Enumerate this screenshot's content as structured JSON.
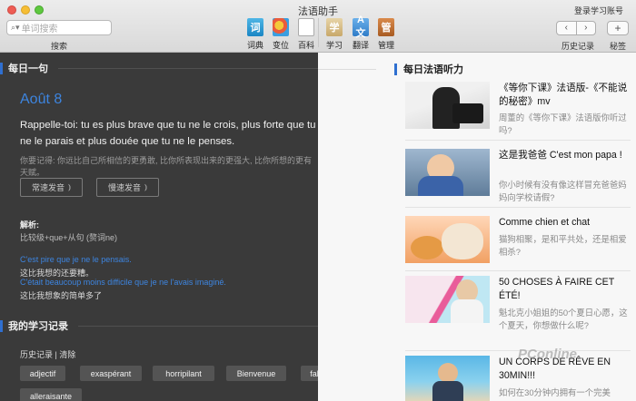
{
  "window": {
    "title": "法语助手",
    "login": "登录学习账号"
  },
  "toolbar": {
    "search_placeholder": "单词搜索",
    "search_caption": "搜索",
    "tools": [
      {
        "label": "词典",
        "icon": "dictionary-icon",
        "glyph": "词"
      },
      {
        "label": "变位",
        "icon": "conjugation-icon",
        "glyph": ""
      },
      {
        "label": "百科",
        "icon": "wikipedia-icon",
        "glyph": "W"
      },
      {
        "label": "学习",
        "icon": "learn-icon",
        "glyph": "学"
      },
      {
        "label": "翻译",
        "icon": "translate-icon",
        "glyph": "A文"
      },
      {
        "label": "管理",
        "icon": "manage-icon",
        "glyph": "管"
      }
    ],
    "back_glyph": "‹",
    "forward_glyph": "›",
    "history_caption": "历史记录",
    "add_glyph": "+",
    "add_caption": "秘签"
  },
  "daily": {
    "heading": "每日一句",
    "date": "Août 8",
    "quote": "Rappelle-toi: tu es plus brave que tu ne le crois, plus forte que tu ne le parais et plus douée que tu ne le penses.",
    "remember": "你要记得: 你远比自己所相信的更勇敢, 比你所表现出来的更强大, 比你所想的更有天赋。",
    "normal_speed": "常速发音",
    "slow_speed": "慢速发音",
    "wave_glyph": "⦆",
    "analysis_title": "解析:",
    "analysis_body": "比较级+que+从句 (赘词ne)",
    "examples": [
      {
        "fr": "C'est pire que je ne le pensais.",
        "zh": "这比我想的还要糟。"
      },
      {
        "fr": "C'était beaucoup moins difficile que je ne l'avais imaginé.",
        "zh": "这比我想象的简单多了"
      }
    ]
  },
  "history": {
    "heading": "我的学习记录",
    "links": "历史记录 | 清除",
    "words": [
      "adjectif",
      "exaspérant",
      "horripilant",
      "Bienvenue",
      "fable",
      "alleraisante"
    ]
  },
  "listening": {
    "heading": "每日法语听力",
    "items": [
      {
        "title": "《等你下课》法语版-《不能说的秘密》mv",
        "desc": "周董的《等你下课》法语版你听过吗?"
      },
      {
        "title": "这是我爸爸 C'est mon papa !",
        "desc": "你小时候有没有像这样冒充爸爸妈妈向学校请假?"
      },
      {
        "title": "Comme chien et chat",
        "desc": "猫狗相聚，是和平共处，还是相爱相杀?"
      },
      {
        "title": "50 CHOSES À FAIRE CET ÉTÉ!",
        "desc": "魁北克小姐姐的50个夏日心愿，这个夏天，你想做什么呢?"
      },
      {
        "title": "UN CORPS DE RÊVE EN 30MIN!!!",
        "desc": "如何在30分钟内拥有一个完美"
      }
    ]
  },
  "watermark": "PConline"
}
